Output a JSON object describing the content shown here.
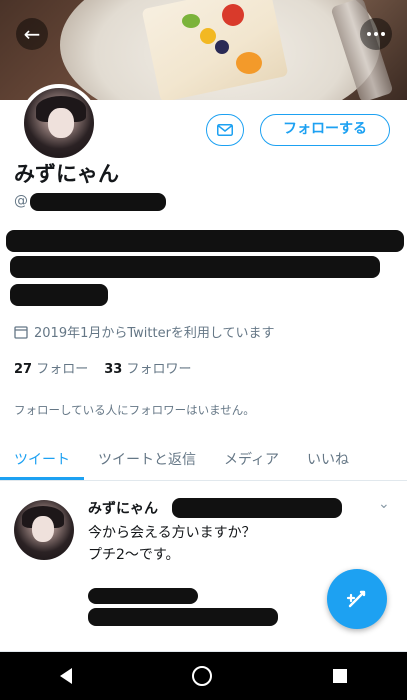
{
  "header": {
    "back_icon": "arrow-left-icon",
    "more_icon": "more-vertical-icon"
  },
  "profile": {
    "name": "みずにゃん",
    "handle": "@",
    "bio_line1": "",
    "bio_line2": "",
    "bio_line3": "",
    "joined": "2019年1月からTwitterを利用しています",
    "following_count": "27",
    "following_label": "フォロー",
    "followers_count": "33",
    "followers_label": "フォロワー",
    "notice": "フォローしている人にフォロワーはいません。"
  },
  "actions": {
    "follow_label": "フォローする",
    "dm_icon": "mail-icon"
  },
  "tabs": [
    {
      "label": "ツイート",
      "active": true
    },
    {
      "label": "ツイートと返信",
      "active": false
    },
    {
      "label": "メディア",
      "active": false
    },
    {
      "label": "いいね",
      "active": false
    }
  ],
  "tweet": {
    "author": "みずにゃん",
    "text_line1": "今から会える方いますか？",
    "text_line2": "プチ2～です。"
  },
  "fab": {
    "icon": "compose-icon"
  },
  "colors": {
    "accent": "#1da1f2",
    "text": "#14171a",
    "muted": "#657786"
  }
}
